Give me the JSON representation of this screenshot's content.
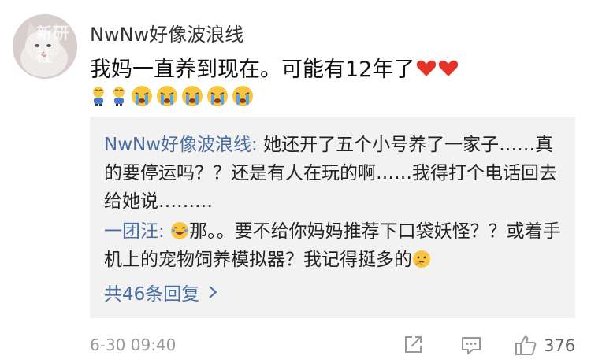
{
  "comment": {
    "watermark": "新研社",
    "username": "NwNw好像波浪线",
    "text": "我妈一直养到现在。可能有12年了",
    "emojis": [
      "small-figure-emoji",
      "small-figure-emoji",
      "crying-face-emoji",
      "crying-face-emoji",
      "crying-face-emoji",
      "crying-face-emoji",
      "crying-face-emoji"
    ]
  },
  "replies": [
    {
      "author": "NwNw好像波浪线",
      "separator": ": ",
      "text": "她还开了五个小号养了一家子……真的要停运吗？？还是有人在玩的啊……我得打个电话回去给她说………"
    },
    {
      "author": "一团汪",
      "separator": ": ",
      "text_after_emoji": "那。。要不给你妈妈推荐下口袋妖怪？？或着手机上的宠物饲养模拟器？我记得挺多的"
    }
  ],
  "more_replies_label": "共46条回复",
  "footer": {
    "timestamp": "6-30 09:40",
    "like_count": "376"
  },
  "colors": {
    "link_blue": "#4a6ea3",
    "reply_background": "#f2f2f2",
    "heart_red": "#e5332a",
    "icon_gray": "#999999"
  }
}
